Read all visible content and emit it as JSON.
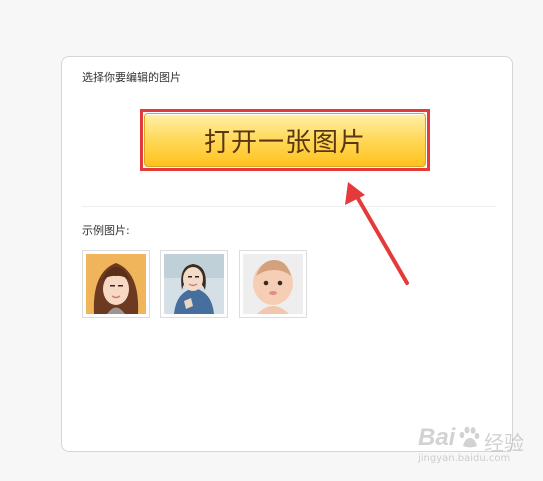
{
  "panel": {
    "instruction": "选择你要编辑的图片",
    "open_button_label": "打开一张图片",
    "examples_label": "示例图片:"
  },
  "examples": [
    {
      "name": "example-photo-woman-bangs"
    },
    {
      "name": "example-photo-woman-denim"
    },
    {
      "name": "example-photo-baby"
    }
  ],
  "watermark": {
    "brand": "Bai",
    "product": "经验",
    "url": "jingyan.baidu.com"
  },
  "colors": {
    "button_top": "#fff0a8",
    "button_bottom": "#ffc21d",
    "button_text": "#5a3710",
    "annotation": "#e53a3a"
  },
  "icons": {
    "annotation": "arrow-icon"
  }
}
